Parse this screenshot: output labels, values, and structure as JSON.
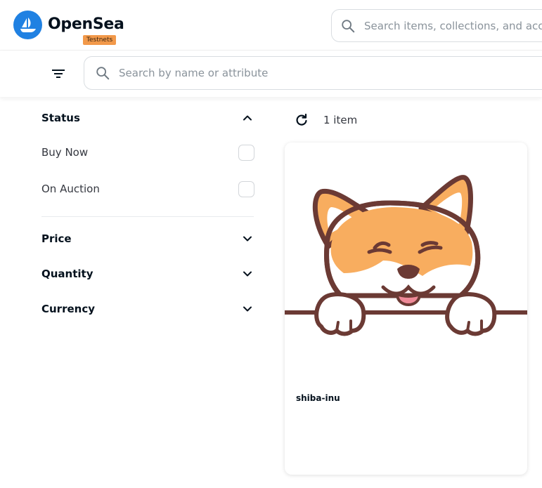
{
  "header": {
    "brand": "OpenSea",
    "network_badge": "Testnets",
    "search_placeholder": "Search items, collections, and accounts"
  },
  "filter_bar": {
    "search_placeholder": "Search by name or attribute"
  },
  "sidebar": {
    "status": {
      "title": "Status",
      "expanded": true,
      "options": [
        {
          "label": "Buy Now",
          "checked": false
        },
        {
          "label": "On Auction",
          "checked": false
        }
      ]
    },
    "sections": [
      {
        "title": "Price",
        "expanded": false
      },
      {
        "title": "Quantity",
        "expanded": false
      },
      {
        "title": "Currency",
        "expanded": false
      }
    ]
  },
  "results": {
    "count_label": "1 item",
    "items": [
      {
        "name": "shiba-inu",
        "image": "shiba-inu-illustration"
      }
    ]
  },
  "colors": {
    "brand_blue": "#2081e2",
    "badge_orange": "#f2994a",
    "text_dark": "#04111d",
    "shiba_orange": "#f8ad5f",
    "shiba_outline": "#6b3a34",
    "tongue_pink": "#ef8a98"
  }
}
